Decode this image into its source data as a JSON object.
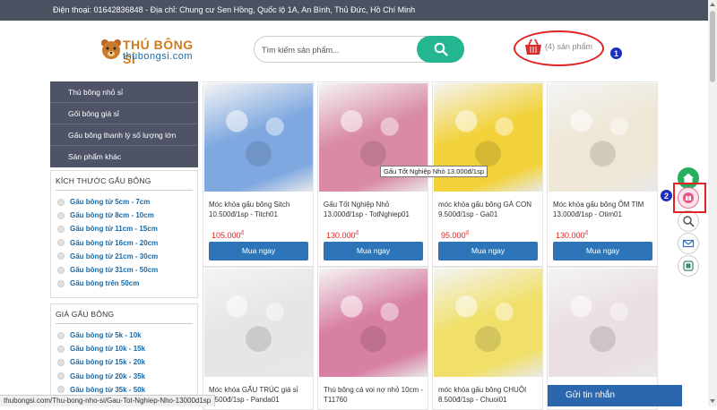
{
  "topbar": {
    "text": "Điện thoại: 01642836848 - Địa chỉ: Chung cư Sen Hồng, Quốc lộ 1A, An Bình, Thủ Đức, Hồ Chí Minh"
  },
  "logo": {
    "title": "THÚ BÔNG SỈ",
    "subtitle": "thubongsi.com"
  },
  "search": {
    "placeholder": "Tìm kiếm sản phẩm...",
    "value": ""
  },
  "cart": {
    "text": "(4) sản phẩm"
  },
  "annotations": {
    "badge1": "1",
    "badge2": "2"
  },
  "sidebar": {
    "menu": [
      "Thú bông nhỏ sỉ",
      "Gối bông giá sỉ",
      "Gấu bông thanh lý số lượng lớn",
      "Sản phẩm khác"
    ],
    "size_filter": {
      "title": "KÍCH THƯỚC GẤU BÔNG",
      "options": [
        "Gấu bông từ 5cm - 7cm",
        "Gấu bông từ 8cm - 10cm",
        "Gấu bông từ 11cm - 15cm",
        "Gấu bông từ 16cm - 20cm",
        "Gấu bông từ 21cm - 30cm",
        "Gấu bông từ 31cm - 50cm",
        "Gấu bông trên 50cm"
      ]
    },
    "price_filter": {
      "title": "GIÁ GẤU BÔNG",
      "options": [
        "Gấu bông từ 5k - 10k",
        "Gấu bông từ 10k - 15k",
        "Gấu bông từ 15k - 20k",
        "Gấu bông từ 20k - 35k",
        "Gấu bông từ 35k - 50k"
      ]
    }
  },
  "products": [
    {
      "name": "Móc khóa gấu bông Sitch 10.500đ/1sp - Titch01",
      "price": "105.000",
      "currency": "đ",
      "buy": "Mua ngay",
      "color": "#7fa8e0"
    },
    {
      "name": "Gấu Tốt Nghiệp Nhỏ 13.000đ/1sp - TotNghiep01",
      "price": "130.000",
      "currency": "đ",
      "buy": "Mua ngay",
      "color": "#d98aa6"
    },
    {
      "name": "móc khóa gấu bông GÀ CON 9.500đ/1sp - Ga01",
      "price": "95.000",
      "currency": "đ",
      "buy": "Mua ngay",
      "color": "#f2d23a"
    },
    {
      "name": "Móc khóa gấu bông ÔM TIM 13.000đ/1sp - Otim01",
      "price": "130.000",
      "currency": "đ",
      "buy": "Mua ngay",
      "color": "#efe7d6"
    },
    {
      "name": "Móc khóa GẤU TRÚC giá sỉ 8.500đ/1sp - Panda01",
      "price": "",
      "currency": "",
      "buy": "",
      "color": "#e6e6e6"
    },
    {
      "name": "Thú bông cá voi nơ nhỏ 10cm - T11760",
      "price": "",
      "currency": "",
      "buy": "",
      "color": "#d87fa4"
    },
    {
      "name": "móc khóa gấu bông CHUỘI 8.500đ/1sp - Chuoi01",
      "price": "",
      "currency": "",
      "buy": "",
      "color": "#f0e06a"
    },
    {
      "name": "",
      "price": "",
      "currency": "",
      "buy": "",
      "color": "#eadfe3"
    }
  ],
  "tooltip": "Gấu Tốt Nghiệp Nhỏ 13.000đ/1sp",
  "chat": {
    "label": "Gửi tin nhắn"
  },
  "statusbar": {
    "url": "thubongsi.com/Thu-bong-nho-si/Gau-Tot-Nghiep-Nho-13000d1sp"
  },
  "colors": {
    "topbar": "#4a5262",
    "sidebar": "#4e5466",
    "accent": "#24b591",
    "button": "#2d74b8",
    "price": "#e02222",
    "link": "#1769a8"
  },
  "float_icons": [
    "home-icon",
    "gift-icon",
    "search-icon",
    "mail-icon",
    "copy-icon"
  ]
}
